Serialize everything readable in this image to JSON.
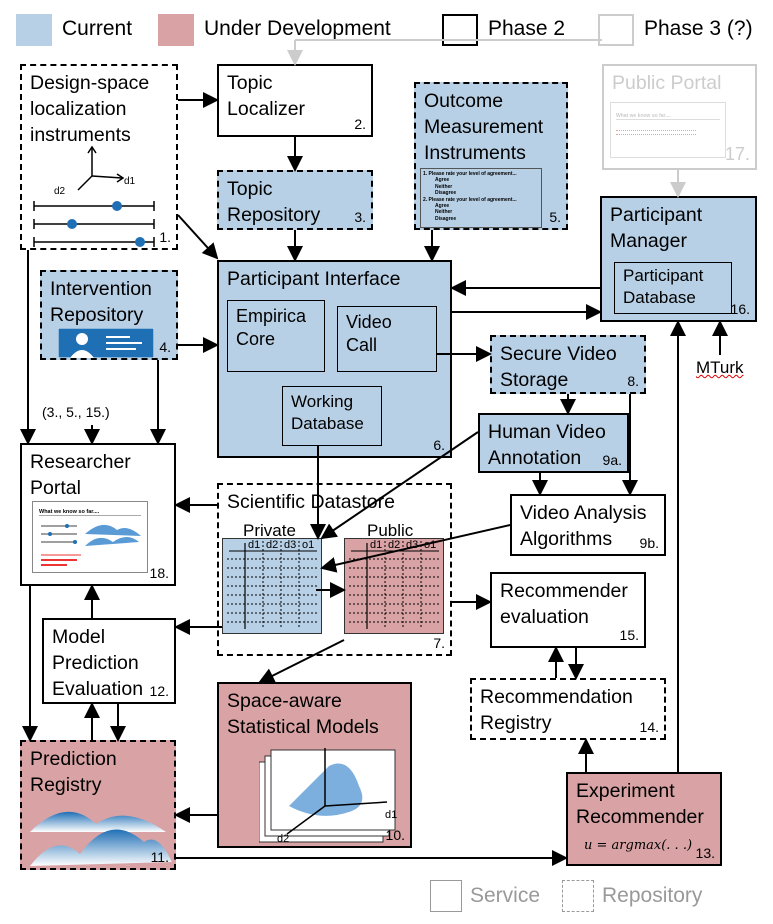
{
  "legend": {
    "current": "Current",
    "under_development": "Under Development",
    "phase2": "Phase 2",
    "phase3": "Phase 3 (?)",
    "service": "Service",
    "repository": "Repository"
  },
  "colors": {
    "current": "#b8d0e6",
    "under_development": "#d9a3a5",
    "phase3": "#cccccc"
  },
  "components": {
    "design_space": {
      "title": "Design-space\nlocalization\ninstruments",
      "num": "1.",
      "axis_labels": [
        "d2",
        "d1"
      ]
    },
    "topic_localizer": {
      "title": "Topic\nLocalizer",
      "num": "2."
    },
    "topic_repository": {
      "title": "Topic\nRepository",
      "num": "3."
    },
    "outcome": {
      "title": "Outcome\nMeasurement\nInstruments",
      "num": "5.",
      "survey": {
        "q1": "1. Please rate your level of agreement...",
        "q2": "2. Please rate your level of agreement...",
        "options": [
          "Agree",
          "Neither",
          "Disagree"
        ]
      }
    },
    "public_portal": {
      "title": "Public Portal",
      "num": "17.",
      "preview": "What we know so far...."
    },
    "participant_manager": {
      "title": "Participant\nManager",
      "num": "16.",
      "inner": "Participant\nDatabase"
    },
    "mturk": "MTurk",
    "participant_interface": {
      "title": "Participant Interface",
      "num": "6.",
      "empirica": "Empirica\nCore",
      "video_call": "Video\nCall",
      "working_db": "Working\nDatabase"
    },
    "intervention": {
      "title": "Intervention\nRepository",
      "num": "4."
    },
    "refs": "(3., 5., 15.)",
    "researcher_portal": {
      "title": "Researcher\nPortal",
      "num": "18.",
      "preview": "What we know so far...."
    },
    "secure_video": {
      "title": "Secure Video\nStorage",
      "num": "8."
    },
    "human_annotation": {
      "title": "Human Video\nAnnotation",
      "num": "9a."
    },
    "video_analysis": {
      "title": "Video Analysis\nAlgorithms",
      "num": "9b."
    },
    "datastore": {
      "title": "Scientific Datastore",
      "num": "7.",
      "private": "Private",
      "public": "Public",
      "columns": [
        "d1",
        "d2",
        "d3",
        "o1"
      ]
    },
    "recommender_eval": {
      "title": "Recommender\nevaluation",
      "num": "15."
    },
    "model_eval": {
      "title": "Model\nPrediction\nEvaluation",
      "num": "12."
    },
    "recommendation_registry": {
      "title": "Recommendation\nRegistry",
      "num": "14."
    },
    "statistical_models": {
      "title": "Space-aware\nStatistical Models",
      "num": "10.",
      "axis_labels": [
        "d2",
        "d1"
      ]
    },
    "prediction_registry": {
      "title": "Prediction\nRegistry",
      "num": "11."
    },
    "experiment_recommender": {
      "title": "Experiment\nRecommender",
      "num": "13.",
      "formula": "u = argmax(. . .)"
    }
  }
}
